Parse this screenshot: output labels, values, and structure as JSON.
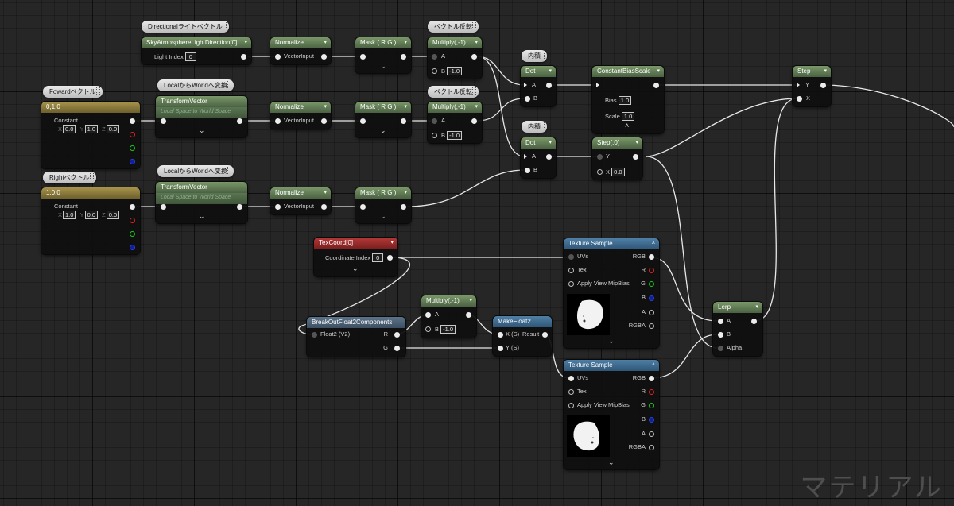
{
  "comments": {
    "dir_light": "Directionalライトベクトル",
    "invert1": "ベクトル反転",
    "invert2": "ベクトル反転",
    "forward": "Fowardベクトル",
    "local_world1": "LocalからWorldへ変換",
    "local_world2": "LocalからWorldへ変換",
    "right": "Rightベクトル",
    "dot1": "内積",
    "dot2": "内積"
  },
  "nodes": {
    "sky": {
      "title": "SkyAtmosphereLightDirection[0]",
      "pin_label": "Light Index",
      "value": "0"
    },
    "normalize1": {
      "title": "Normalize",
      "pin": "VectorInput"
    },
    "normalize2": {
      "title": "Normalize",
      "pin": "VectorInput"
    },
    "normalize3": {
      "title": "Normalize",
      "pin": "VectorInput"
    },
    "mask1": {
      "title": "Mask ( R G )"
    },
    "mask2": {
      "title": "Mask ( R G )"
    },
    "mask3": {
      "title": "Mask ( R G )"
    },
    "mult1": {
      "title": "Multiply(,-1)",
      "a": "A",
      "b": "B",
      "b_value": "-1.0"
    },
    "mult2": {
      "title": "Multiply(,-1)",
      "a": "A",
      "b": "B",
      "b_value": "-1.0"
    },
    "mult3": {
      "title": "Multiply(,-1)",
      "a": "A",
      "b": "B",
      "b_value": "-1.0"
    },
    "const_fwd": {
      "title": "0,1,0",
      "label": "Constant",
      "x": "0.0",
      "y": "1.0",
      "z": "0.0"
    },
    "const_right": {
      "title": "1,0,0",
      "label": "Constant",
      "x": "1.0",
      "y": "0.0",
      "z": "0.0"
    },
    "xyz_labels": {
      "x": "X",
      "y": "Y",
      "z": "Z"
    },
    "tv1": {
      "title": "TransformVector",
      "subtitle": "Local Space to World Space"
    },
    "tv2": {
      "title": "TransformVector",
      "subtitle": "Local Space to World Space"
    },
    "dot1": {
      "title": "Dot",
      "a": "A",
      "b": "B"
    },
    "dot2": {
      "title": "Dot",
      "a": "A",
      "b": "B"
    },
    "cbs": {
      "title": "ConstantBiasScale",
      "bias_label": "Bias",
      "bias": "1.0",
      "scale_label": "Scale",
      "scale": "1.0"
    },
    "step0": {
      "title": "Step(,0)",
      "y": "Y",
      "x": "X",
      "x_value": "0.0"
    },
    "step": {
      "title": "Step",
      "y": "Y",
      "x": "X"
    },
    "texcoord": {
      "title": "TexCoord[0]",
      "label": "Coordinate Index",
      "value": "0"
    },
    "breakout": {
      "title": "BreakOutFloat2Components",
      "input": "Float2 (V2)",
      "r": "R",
      "g": "G"
    },
    "makefloat": {
      "title": "MakeFloat2",
      "x": "X (S)",
      "y": "Y (S)",
      "result": "Result"
    },
    "tex1": {
      "title": "Texture Sample",
      "uvs": "UVs",
      "tex": "Tex",
      "mip": "Apply View MipBias",
      "rgb": "RGB",
      "r": "R",
      "g": "G",
      "b": "B",
      "a": "A",
      "rgba": "RGBA"
    },
    "tex2": {
      "title": "Texture Sample",
      "uvs": "UVs",
      "tex": "Tex",
      "mip": "Apply View MipBias",
      "rgb": "RGB",
      "r": "R",
      "g": "G",
      "b": "B",
      "a": "A",
      "rgba": "RGBA"
    },
    "lerp": {
      "title": "Lerp",
      "a": "A",
      "b": "B",
      "alpha": "Alpha"
    }
  },
  "watermark": "マテリアル"
}
